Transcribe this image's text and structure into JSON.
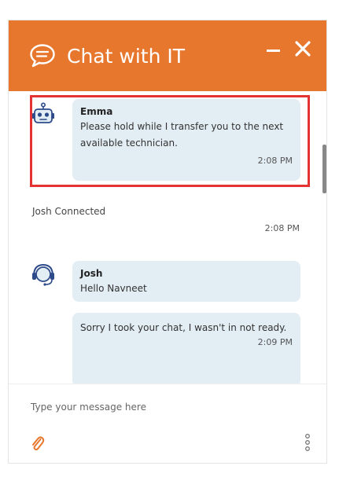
{
  "header": {
    "title": "Chat with IT",
    "icons": {
      "chat": "chat-bubble-icon",
      "minimize": "minimize-icon",
      "close": "close-icon"
    },
    "accent_color": "#e8772e"
  },
  "messages": [
    {
      "sender": "Emma",
      "avatar": "robot-icon",
      "text": "Please hold while I transfer you to the next available technician.",
      "time": "2:08 PM",
      "highlighted": true,
      "highlight_color": "#e53333"
    },
    {
      "type": "system",
      "text": "Josh Connected",
      "time": "2:08 PM"
    },
    {
      "sender": "Josh",
      "avatar": "headset-agent-icon",
      "text": "Hello Navneet"
    },
    {
      "sender": "Josh",
      "text": "Sorry I took your chat, I wasn't in not ready.",
      "time": "2:09 PM"
    }
  ],
  "composer": {
    "placeholder": "Type your message here",
    "attach_icon": "paperclip-icon",
    "more_icon": "vertical-dots-icon"
  },
  "colors": {
    "bubble": "#e3edf4",
    "header": "#e8772e",
    "attach_icon": "#e8772e"
  }
}
